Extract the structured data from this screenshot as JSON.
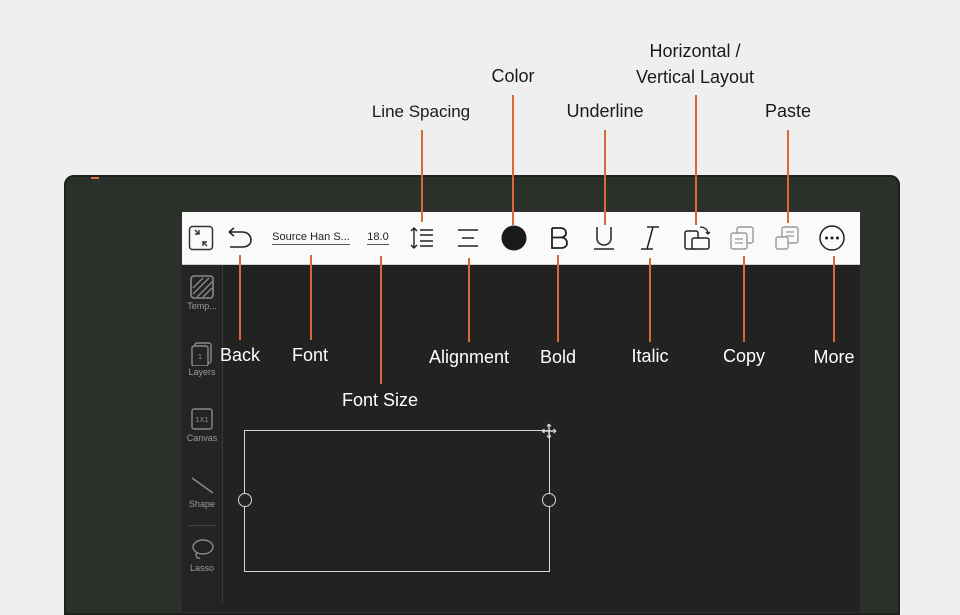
{
  "toolbar": {
    "font_name": "Source Han S...",
    "font_size": "18.0"
  },
  "sidebar": {
    "items": [
      {
        "label": "Temp...",
        "icon": "template-icon"
      },
      {
        "label": "Layers",
        "icon": "layers-icon"
      },
      {
        "label": "Canvas",
        "icon": "canvas-icon",
        "badge": "1X1"
      },
      {
        "label": "Shape",
        "icon": "shape-icon"
      },
      {
        "label": "Lasso",
        "icon": "lasso-icon"
      }
    ]
  },
  "callouts": {
    "line_spacing": "Line Spacing",
    "color": "Color",
    "underline": "Underline",
    "layout_line1": "Horizontal /",
    "layout_line2": "Vertical Layout",
    "paste": "Paste",
    "back": "Back",
    "font": "Font",
    "font_size": "Font Size",
    "alignment": "Alignment",
    "bold": "Bold",
    "italic": "Italic",
    "copy": "Copy",
    "more": "More"
  },
  "colors": {
    "accent_line": "#d9683a",
    "device_frame": "#2c302b",
    "screen_bg": "#222222",
    "toolbar_bg": "#fafafa",
    "background": "#efefef"
  }
}
